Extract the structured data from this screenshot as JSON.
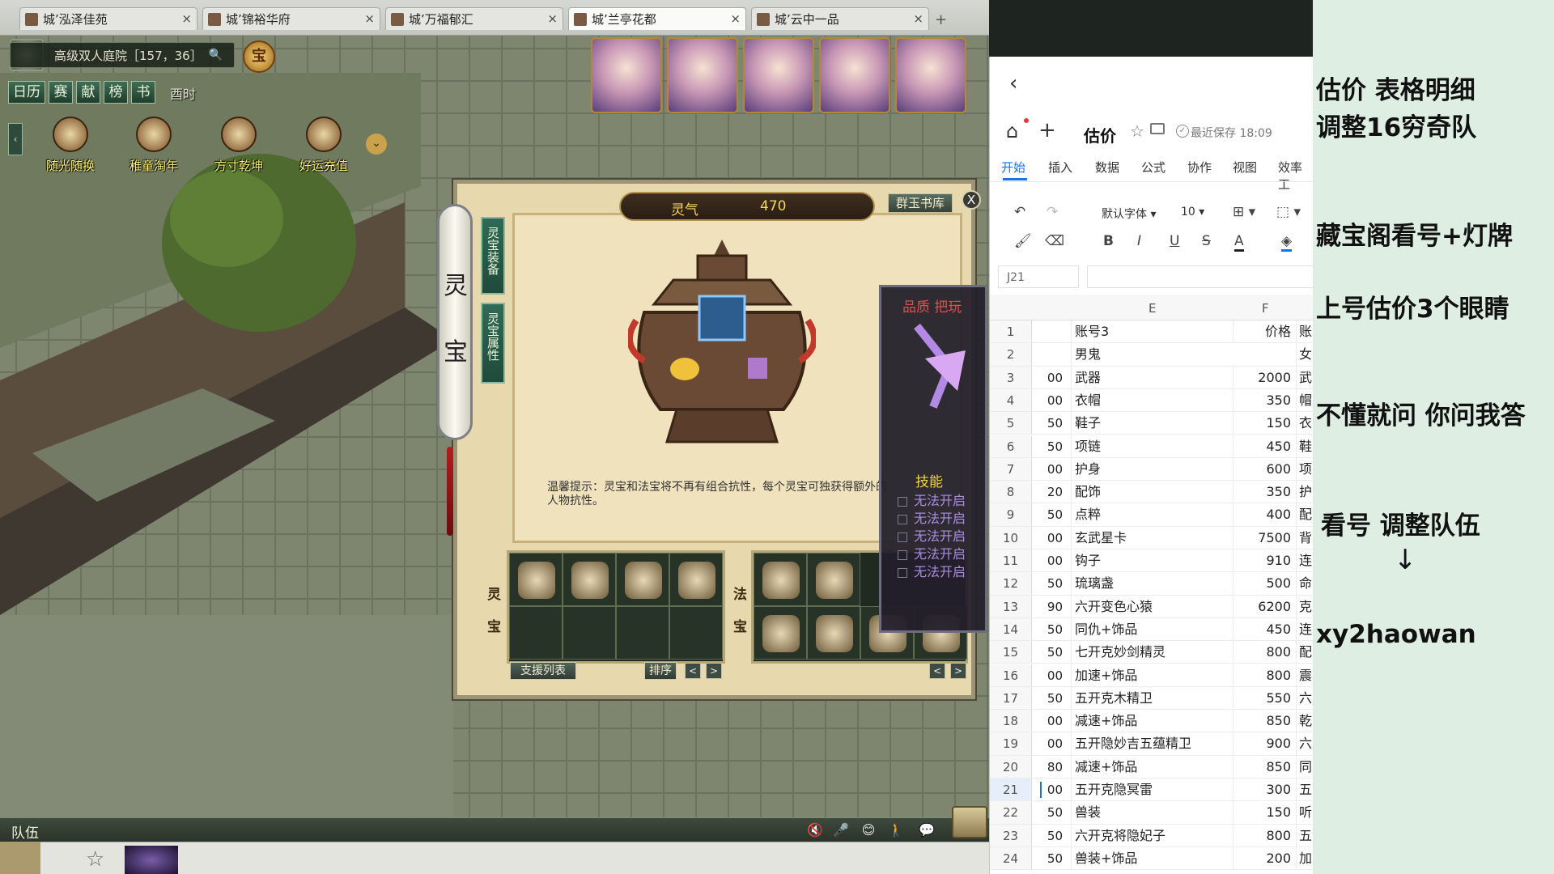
{
  "browser_tabs": [
    {
      "label": "城’泓泽佳苑",
      "active": false
    },
    {
      "label": "城’锦裕华府",
      "active": false
    },
    {
      "label": "城’万福郁汇",
      "active": false
    },
    {
      "label": "城’兰亭花都",
      "active": true
    },
    {
      "label": "城’云中一品",
      "active": false
    }
  ],
  "tab_add_label": "+",
  "tab_close_label": "×",
  "game": {
    "location": "高级双人庭院［157，36］",
    "search_icon": "🔍",
    "gold_medal_label": "宝",
    "quick_buttons": [
      "日历",
      "赛",
      "献",
      "榜",
      "书"
    ],
    "time_label": "酉时",
    "activities": [
      "随光随换",
      "稚童淘年",
      "方寸乾坤",
      "好运充值"
    ],
    "dialog": {
      "lingqi_label": "灵气",
      "lingqi_value": "470",
      "shuku_label": "群玉书库",
      "close_label": "X",
      "vtabs": [
        "灵宝装备",
        "灵宝属性"
      ],
      "scroll_chars": [
        "灵",
        "宝"
      ],
      "tip": "温馨提示：灵宝和法宝将不再有组合抗性，每个灵宝可独获得额外的人物抗性。",
      "lingbao_label": [
        "灵",
        "宝"
      ],
      "fabao_label": [
        "法",
        "宝"
      ],
      "support_list_label": "支援列表",
      "sort_label": "排序",
      "prev_label": "<",
      "next_label": ">"
    },
    "skill_panel": {
      "head": "品质  把玩",
      "title": "技能",
      "rows": [
        "无法开启",
        "无法开启",
        "无法开启",
        "无法开启",
        "无法开启"
      ]
    },
    "bottom": {
      "team_label": "队伍",
      "icons": [
        "🔇",
        "🎤",
        "😊",
        "🚶",
        "💬"
      ]
    }
  },
  "sheet": {
    "back_icon": "‹",
    "home_icon": "⌂",
    "plus_icon": "+",
    "doc_title": "估价",
    "star_icon": "☆",
    "saved_text": "最近保存 18:09",
    "menus": [
      "开始",
      "插入",
      "数据",
      "公式",
      "协作",
      "视图",
      "效率工"
    ],
    "active_menu": "开始",
    "toolbar": {
      "undo": "↶",
      "redo": "↷",
      "font": "默认字体 ▾",
      "size": "10 ▾",
      "borders": "⊞ ▾",
      "merge": "⬚ ▾",
      "format_painter": "🖌",
      "eraser": "⌫",
      "bold": "B",
      "italic": "I",
      "underline": "U",
      "strike": "S",
      "font_color": "A",
      "fill": "◈"
    },
    "name_box": "J21",
    "col_headers": {
      "e": "E",
      "f": "F"
    },
    "rows": [
      {
        "n": "1",
        "d": "",
        "e": "账号3",
        "f": "价格",
        "g": "账"
      },
      {
        "n": "2",
        "d": "",
        "e": "男鬼",
        "f": "",
        "g": "女"
      },
      {
        "n": "3",
        "d": "00",
        "e": "武器",
        "f": "2000",
        "g": "武"
      },
      {
        "n": "4",
        "d": "00",
        "e": "衣帽",
        "f": "350",
        "g": "帽"
      },
      {
        "n": "5",
        "d": "50",
        "e": "鞋子",
        "f": "150",
        "g": "衣"
      },
      {
        "n": "6",
        "d": "50",
        "e": "项链",
        "f": "450",
        "g": "鞋"
      },
      {
        "n": "7",
        "d": "00",
        "e": "护身",
        "f": "600",
        "g": "项"
      },
      {
        "n": "8",
        "d": "20",
        "e": "配饰",
        "f": "350",
        "g": "护"
      },
      {
        "n": "9",
        "d": "50",
        "e": "点粹",
        "f": "400",
        "g": "配"
      },
      {
        "n": "10",
        "d": "00",
        "e": "玄武星卡",
        "f": "7500",
        "g": "背"
      },
      {
        "n": "11",
        "d": "00",
        "e": "钩子",
        "f": "910",
        "g": "连"
      },
      {
        "n": "12",
        "d": "50",
        "e": "琉璃盏",
        "f": "500",
        "g": "命"
      },
      {
        "n": "13",
        "d": "90",
        "e": "六开变色心猿",
        "f": "6200",
        "g": "克"
      },
      {
        "n": "14",
        "d": "50",
        "e": "同仇+饰品",
        "f": "450",
        "g": "连"
      },
      {
        "n": "15",
        "d": "50",
        "e": "七开克妙剑精灵",
        "f": "800",
        "g": "配"
      },
      {
        "n": "16",
        "d": "00",
        "e": "加速+饰品",
        "f": "800",
        "g": "震"
      },
      {
        "n": "17",
        "d": "50",
        "e": "五开克木精卫",
        "f": "550",
        "g": "六"
      },
      {
        "n": "18",
        "d": "00",
        "e": "减速+饰品",
        "f": "850",
        "g": "乾"
      },
      {
        "n": "19",
        "d": "00",
        "e": "五开隐妙吉五蕴精卫",
        "f": "900",
        "g": "六"
      },
      {
        "n": "20",
        "d": "80",
        "e": "减速+饰品",
        "f": "850",
        "g": "同"
      },
      {
        "n": "21",
        "d": "00",
        "e": "五开克隐冥雷",
        "f": "300",
        "g": "五"
      },
      {
        "n": "22",
        "d": "50",
        "e": "兽装",
        "f": "150",
        "g": "听"
      },
      {
        "n": "23",
        "d": "50",
        "e": "六开克将隐妃子",
        "f": "800",
        "g": "五"
      },
      {
        "n": "24",
        "d": "50",
        "e": "兽装+饰品",
        "f": "200",
        "g": "加"
      }
    ],
    "selected_row": "21"
  },
  "notes": {
    "line1": "估价  表格明细",
    "line2": "调整16穷奇队",
    "line3": "藏宝阁看号+灯牌",
    "line4": "上号估价3个眼睛",
    "line5": "不懂就问 你问我答",
    "line6": "看号 调整队伍",
    "arrow": "↓",
    "line7": "xy2haowan"
  },
  "colors": {
    "accent_blue": "#1a73e8",
    "note_bg": "#dfeee2",
    "game_gold": "#f8d75a"
  }
}
